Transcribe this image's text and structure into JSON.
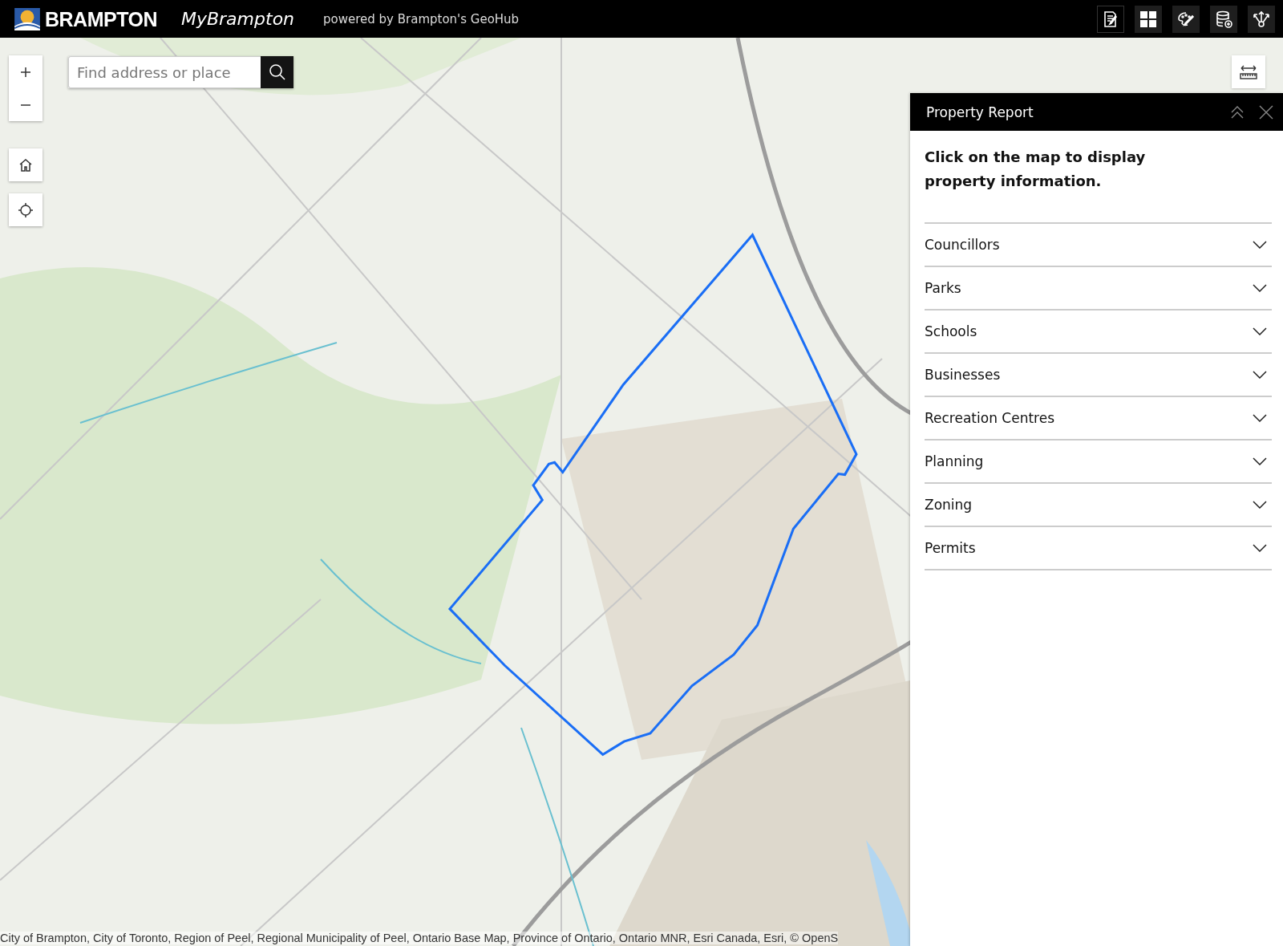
{
  "header": {
    "logo_text": "BRAMPTON",
    "app_title": "MyBrampton",
    "subtitle": "powered by Brampton's GeoHub"
  },
  "map": {
    "search": {
      "placeholder": "Find address or place"
    },
    "attribution": "City of Brampton, City of Toronto, Region of Peel, Regional Municipality of Peel, Ontario Base Map, Province of Ontario, Ontario MNR, Esri Canada, Esri, © OpenS"
  },
  "panel": {
    "title": "Property Report",
    "message": "Click on the map to display property information.",
    "sections": [
      {
        "label": "Councillors",
        "expanded": false
      },
      {
        "label": "Parks",
        "expanded": false
      },
      {
        "label": "Schools",
        "expanded": false
      },
      {
        "label": "Businesses",
        "expanded": false
      },
      {
        "label": "Recreation Centres",
        "expanded": false
      },
      {
        "label": "Planning",
        "expanded": false
      },
      {
        "label": "Zoning",
        "expanded": false
      },
      {
        "label": "Permits",
        "expanded": false
      }
    ]
  }
}
